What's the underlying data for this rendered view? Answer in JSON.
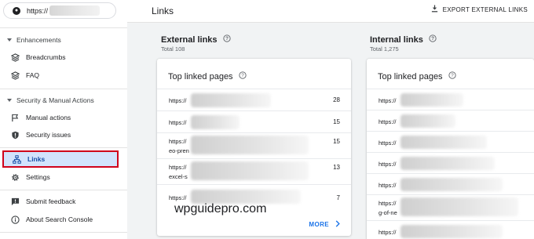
{
  "url": {
    "prefix": "https://"
  },
  "sidebar": {
    "enhancements": {
      "label": "Enhancements",
      "items": [
        {
          "label": "Breadcrumbs",
          "icon": "breadcrumbs-icon"
        },
        {
          "label": "FAQ",
          "icon": "faq-icon"
        }
      ]
    },
    "security": {
      "label": "Security & Manual Actions",
      "items": [
        {
          "label": "Manual actions",
          "icon": "flag-icon"
        },
        {
          "label": "Security issues",
          "icon": "shield-icon"
        }
      ]
    },
    "links": {
      "label": "Links",
      "icon": "sitemap-icon",
      "active": true
    },
    "settings": {
      "label": "Settings",
      "icon": "gear-icon"
    },
    "submit_feedback": {
      "label": "Submit feedback",
      "icon": "feedback-icon"
    },
    "about": {
      "label": "About Search Console",
      "icon": "info-icon"
    }
  },
  "header": {
    "title": "Links",
    "export_label": "EXPORT EXTERNAL LINKS"
  },
  "external": {
    "title": "External links",
    "total": "Total 108",
    "card_title": "Top linked pages",
    "rows": [
      {
        "url": "https://",
        "count": "28"
      },
      {
        "url": "https://",
        "count": "15"
      },
      {
        "url": "https://",
        "suffix": "eo-pren",
        "count": "15"
      },
      {
        "url": "https://",
        "suffix": "excel-s",
        "count": "13"
      },
      {
        "url": "https://",
        "count": "7"
      }
    ],
    "more_label": "MORE"
  },
  "internal": {
    "title": "Internal links",
    "total": "Total 1,275",
    "card_title": "Top linked pages",
    "rows": [
      {
        "url": "https://"
      },
      {
        "url": "https://"
      },
      {
        "url": "https://"
      },
      {
        "url": "https://"
      },
      {
        "url": "https://"
      },
      {
        "url": "https://",
        "suffix": "g-of-ne"
      },
      {
        "url": "https://"
      }
    ]
  },
  "watermark": "wpguidepro.com",
  "colors": {
    "accent": "#1a73e8",
    "active_bg": "#d2e3fc",
    "highlight_border": "#d0021b",
    "main_bg": "#f1f3f4"
  }
}
